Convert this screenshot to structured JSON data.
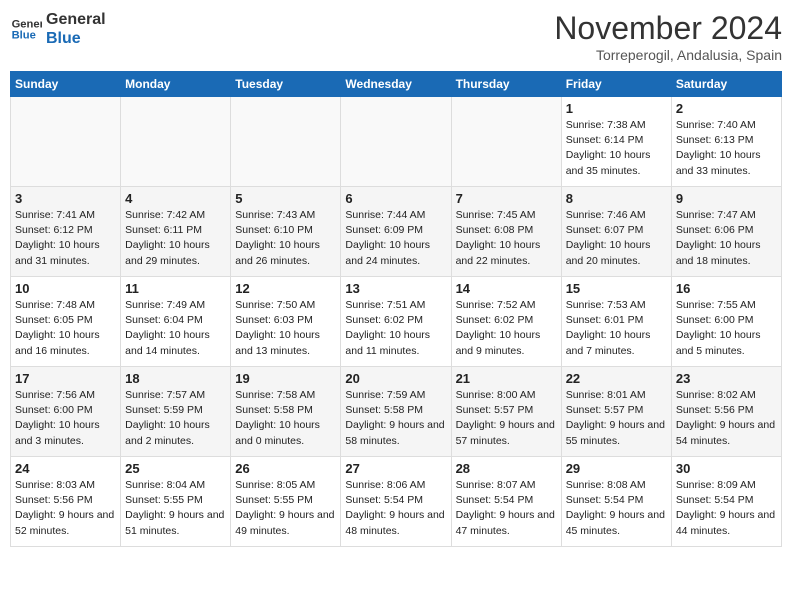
{
  "header": {
    "logo_line1": "General",
    "logo_line2": "Blue",
    "month_title": "November 2024",
    "subtitle": "Torreperogil, Andalusia, Spain"
  },
  "weekdays": [
    "Sunday",
    "Monday",
    "Tuesday",
    "Wednesday",
    "Thursday",
    "Friday",
    "Saturday"
  ],
  "weeks": [
    [
      {
        "day": "",
        "info": ""
      },
      {
        "day": "",
        "info": ""
      },
      {
        "day": "",
        "info": ""
      },
      {
        "day": "",
        "info": ""
      },
      {
        "day": "",
        "info": ""
      },
      {
        "day": "1",
        "info": "Sunrise: 7:38 AM\nSunset: 6:14 PM\nDaylight: 10 hours and 35 minutes."
      },
      {
        "day": "2",
        "info": "Sunrise: 7:40 AM\nSunset: 6:13 PM\nDaylight: 10 hours and 33 minutes."
      }
    ],
    [
      {
        "day": "3",
        "info": "Sunrise: 7:41 AM\nSunset: 6:12 PM\nDaylight: 10 hours and 31 minutes."
      },
      {
        "day": "4",
        "info": "Sunrise: 7:42 AM\nSunset: 6:11 PM\nDaylight: 10 hours and 29 minutes."
      },
      {
        "day": "5",
        "info": "Sunrise: 7:43 AM\nSunset: 6:10 PM\nDaylight: 10 hours and 26 minutes."
      },
      {
        "day": "6",
        "info": "Sunrise: 7:44 AM\nSunset: 6:09 PM\nDaylight: 10 hours and 24 minutes."
      },
      {
        "day": "7",
        "info": "Sunrise: 7:45 AM\nSunset: 6:08 PM\nDaylight: 10 hours and 22 minutes."
      },
      {
        "day": "8",
        "info": "Sunrise: 7:46 AM\nSunset: 6:07 PM\nDaylight: 10 hours and 20 minutes."
      },
      {
        "day": "9",
        "info": "Sunrise: 7:47 AM\nSunset: 6:06 PM\nDaylight: 10 hours and 18 minutes."
      }
    ],
    [
      {
        "day": "10",
        "info": "Sunrise: 7:48 AM\nSunset: 6:05 PM\nDaylight: 10 hours and 16 minutes."
      },
      {
        "day": "11",
        "info": "Sunrise: 7:49 AM\nSunset: 6:04 PM\nDaylight: 10 hours and 14 minutes."
      },
      {
        "day": "12",
        "info": "Sunrise: 7:50 AM\nSunset: 6:03 PM\nDaylight: 10 hours and 13 minutes."
      },
      {
        "day": "13",
        "info": "Sunrise: 7:51 AM\nSunset: 6:02 PM\nDaylight: 10 hours and 11 minutes."
      },
      {
        "day": "14",
        "info": "Sunrise: 7:52 AM\nSunset: 6:02 PM\nDaylight: 10 hours and 9 minutes."
      },
      {
        "day": "15",
        "info": "Sunrise: 7:53 AM\nSunset: 6:01 PM\nDaylight: 10 hours and 7 minutes."
      },
      {
        "day": "16",
        "info": "Sunrise: 7:55 AM\nSunset: 6:00 PM\nDaylight: 10 hours and 5 minutes."
      }
    ],
    [
      {
        "day": "17",
        "info": "Sunrise: 7:56 AM\nSunset: 6:00 PM\nDaylight: 10 hours and 3 minutes."
      },
      {
        "day": "18",
        "info": "Sunrise: 7:57 AM\nSunset: 5:59 PM\nDaylight: 10 hours and 2 minutes."
      },
      {
        "day": "19",
        "info": "Sunrise: 7:58 AM\nSunset: 5:58 PM\nDaylight: 10 hours and 0 minutes."
      },
      {
        "day": "20",
        "info": "Sunrise: 7:59 AM\nSunset: 5:58 PM\nDaylight: 9 hours and 58 minutes."
      },
      {
        "day": "21",
        "info": "Sunrise: 8:00 AM\nSunset: 5:57 PM\nDaylight: 9 hours and 57 minutes."
      },
      {
        "day": "22",
        "info": "Sunrise: 8:01 AM\nSunset: 5:57 PM\nDaylight: 9 hours and 55 minutes."
      },
      {
        "day": "23",
        "info": "Sunrise: 8:02 AM\nSunset: 5:56 PM\nDaylight: 9 hours and 54 minutes."
      }
    ],
    [
      {
        "day": "24",
        "info": "Sunrise: 8:03 AM\nSunset: 5:56 PM\nDaylight: 9 hours and 52 minutes."
      },
      {
        "day": "25",
        "info": "Sunrise: 8:04 AM\nSunset: 5:55 PM\nDaylight: 9 hours and 51 minutes."
      },
      {
        "day": "26",
        "info": "Sunrise: 8:05 AM\nSunset: 5:55 PM\nDaylight: 9 hours and 49 minutes."
      },
      {
        "day": "27",
        "info": "Sunrise: 8:06 AM\nSunset: 5:54 PM\nDaylight: 9 hours and 48 minutes."
      },
      {
        "day": "28",
        "info": "Sunrise: 8:07 AM\nSunset: 5:54 PM\nDaylight: 9 hours and 47 minutes."
      },
      {
        "day": "29",
        "info": "Sunrise: 8:08 AM\nSunset: 5:54 PM\nDaylight: 9 hours and 45 minutes."
      },
      {
        "day": "30",
        "info": "Sunrise: 8:09 AM\nSunset: 5:54 PM\nDaylight: 9 hours and 44 minutes."
      }
    ]
  ]
}
